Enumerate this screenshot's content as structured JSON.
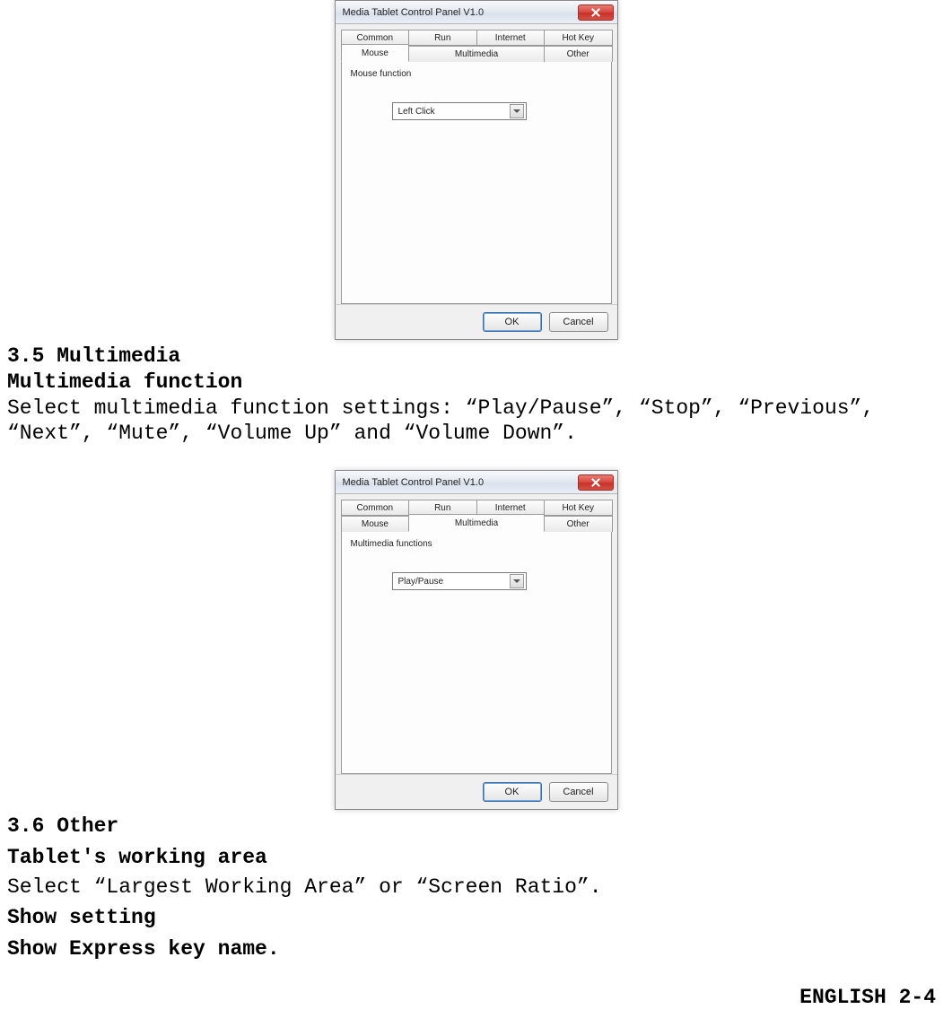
{
  "dialog1": {
    "title": "Media Tablet Control Panel V1.0",
    "tabs_back": [
      "Common",
      "Run",
      "Internet",
      "Hot Key"
    ],
    "tabs_front": [
      "Mouse",
      "Multimedia",
      "Other"
    ],
    "active_tab": "Mouse",
    "panel_label": "Mouse function",
    "dropdown_value": "Left Click",
    "ok": "OK",
    "cancel": "Cancel"
  },
  "section35": {
    "heading": "3.5 Multimedia",
    "subheading": "Multimedia function",
    "body": "Select multimedia function settings: “Play/Pause”, “Stop”, “Previous”, “Next”, “Mute”, “Volume Up” and “Volume Down”."
  },
  "dialog2": {
    "title": "Media Tablet Control Panel V1.0",
    "tabs_back": [
      "Common",
      "Run",
      "Internet",
      "Hot Key"
    ],
    "tabs_front": [
      "Mouse",
      "Multimedia",
      "Other"
    ],
    "active_tab": "Multimedia",
    "panel_label": "Multimedia functions",
    "dropdown_value": "Play/Pause",
    "ok": "OK",
    "cancel": "Cancel"
  },
  "section36": {
    "heading": "3.6  Other",
    "sub1": "Tablet's working area",
    "body1": "Select “Largest Working Area” or “Screen Ratio”.",
    "sub2": "Show setting",
    "sub3": "Show Express key name."
  },
  "footer": "ENGLISH 2-4"
}
